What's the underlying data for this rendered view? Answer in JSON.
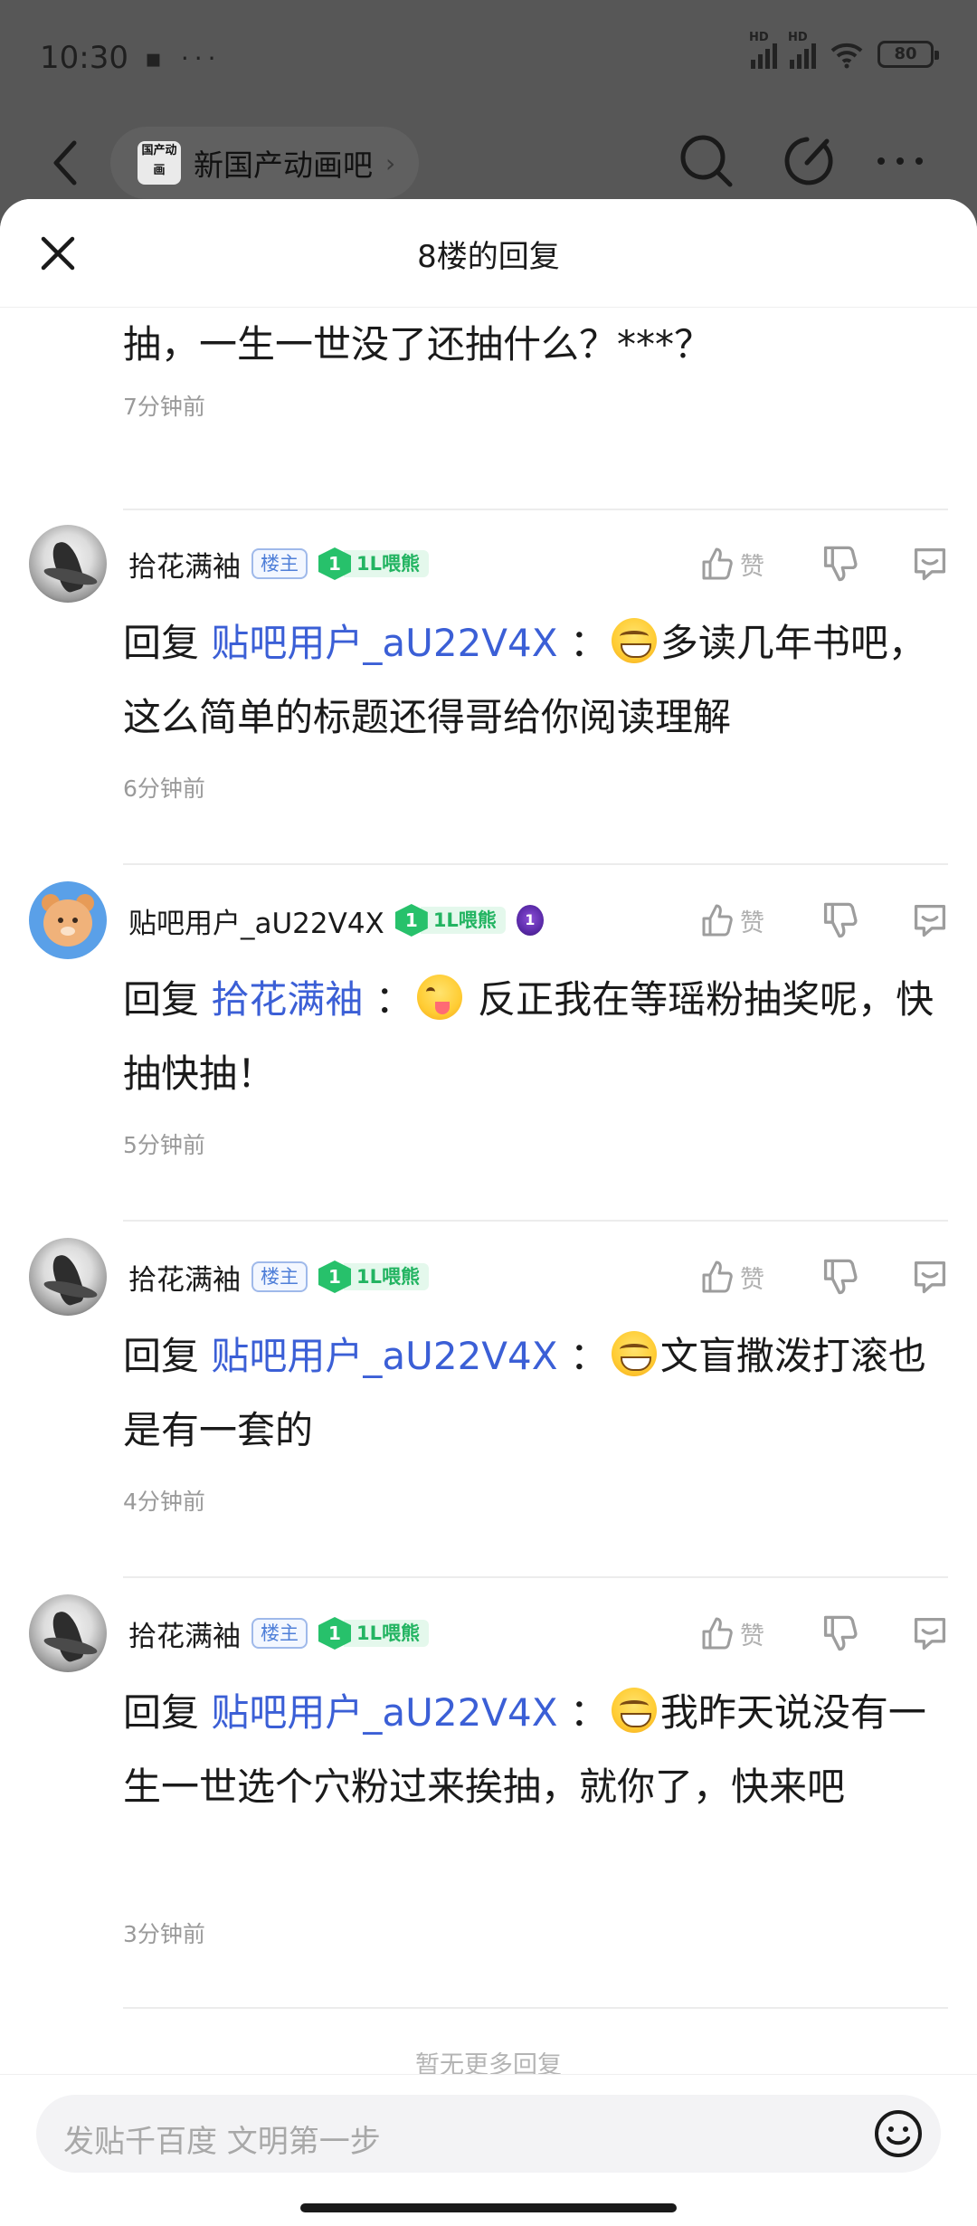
{
  "status_bar": {
    "time": "10:30",
    "left_icons": "▪ ···",
    "network_1": "HD",
    "network_2": "HD",
    "battery": "80"
  },
  "nav": {
    "forum_logo": "国产动画",
    "forum_name": "新国产动画吧",
    "chevron": "›"
  },
  "sheet": {
    "title": "8楼的回复"
  },
  "partial_reply": {
    "text": "抽，一生一世没了还抽什么？***？",
    "time": "7分钟前"
  },
  "replies": [
    {
      "username": "拾花满袖",
      "is_op": true,
      "op_label": "楼主",
      "level": "1",
      "level_name": "1L喂熊",
      "has_medal": false,
      "reply_prefix": "回复",
      "mention": "贴吧用户_aU22V4X",
      "colon": "：",
      "emoji": "grin",
      "body": "多读几年书吧，这么简单的标题还得哥给你阅读理解",
      "time": "6分钟前",
      "like_label": "赞"
    },
    {
      "username": "贴吧用户_aU22V4X",
      "is_op": false,
      "level": "1",
      "level_name": "1L喂熊",
      "has_medal": true,
      "medal_label": "1",
      "reply_prefix": "回复",
      "mention": "拾花满袖",
      "colon": "：",
      "emoji": "tongue",
      "body": " 反正我在等瑶粉抽奖呢，快抽快抽！",
      "time": "5分钟前",
      "like_label": "赞"
    },
    {
      "username": "拾花满袖",
      "is_op": true,
      "op_label": "楼主",
      "level": "1",
      "level_name": "1L喂熊",
      "has_medal": false,
      "reply_prefix": "回复",
      "mention": "贴吧用户_aU22V4X",
      "colon": "：",
      "emoji": "grin",
      "body": "文盲撒泼打滚也是有一套的",
      "time": "4分钟前",
      "like_label": "赞"
    },
    {
      "username": "拾花满袖",
      "is_op": true,
      "op_label": "楼主",
      "level": "1",
      "level_name": "1L喂熊",
      "has_medal": false,
      "reply_prefix": "回复",
      "mention": "贴吧用户_aU22V4X",
      "colon": "：",
      "emoji": "grin",
      "body": "我昨天说没有一生一世选个穴粉过来挨抽，就你了，快来吧",
      "time": "3分钟前",
      "like_label": "赞"
    }
  ],
  "footer": {
    "no_more": "暂无更多回复",
    "compose_placeholder": "发贴千百度 文明第一步"
  },
  "colors": {
    "mention": "#3b5fd6",
    "level_green": "#27c16b",
    "op_blue": "#4f7fd8",
    "overlay": "#575757"
  }
}
